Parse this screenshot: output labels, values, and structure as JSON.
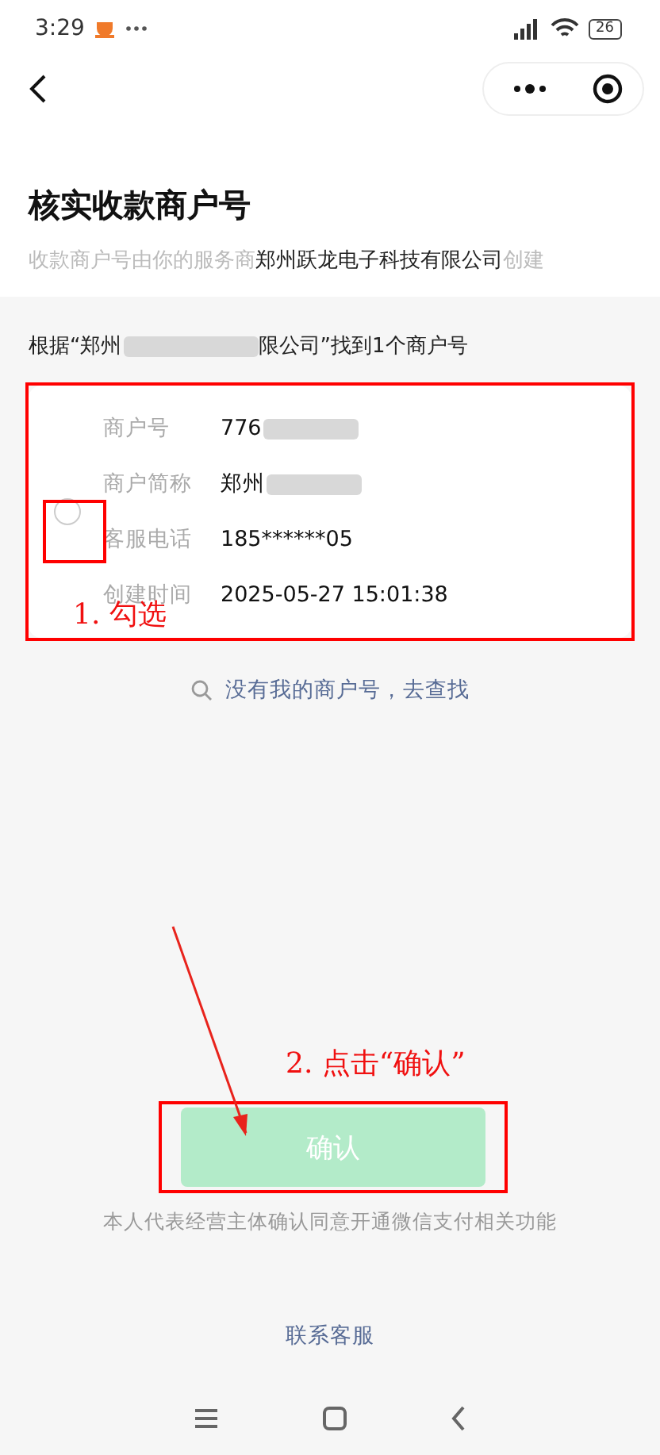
{
  "status_bar": {
    "time": "3:29",
    "battery": "26"
  },
  "header": {
    "title": "核实收款商户号",
    "subtitle_prefix": "收款商户号由你的服务商",
    "subtitle_company": "郑州跃龙电子科技有限公司",
    "subtitle_suffix": "创建"
  },
  "result_line": {
    "prefix": "根据“郑州",
    "suffix": "限公司”找到1个商户号",
    "redacted": true
  },
  "merchant": {
    "selected": false,
    "fields": [
      {
        "label": "商户号",
        "value": "776",
        "redacted": true
      },
      {
        "label": "商户简称",
        "value": "郑州",
        "redacted": true
      },
      {
        "label": "客服电话",
        "value": "185******05",
        "redacted": false
      },
      {
        "label": "创建时间",
        "value": "2025-05-27 15:01:38",
        "redacted": false
      }
    ]
  },
  "search_link": "没有我的商户号，去查找",
  "confirm_button": {
    "label": "确认",
    "disabled": true
  },
  "agreement": "本人代表经营主体确认同意开通微信支付相关功能",
  "contact_link": "联系客服",
  "annotations": [
    "1. 勾选",
    "2. 点击“确认”"
  ]
}
